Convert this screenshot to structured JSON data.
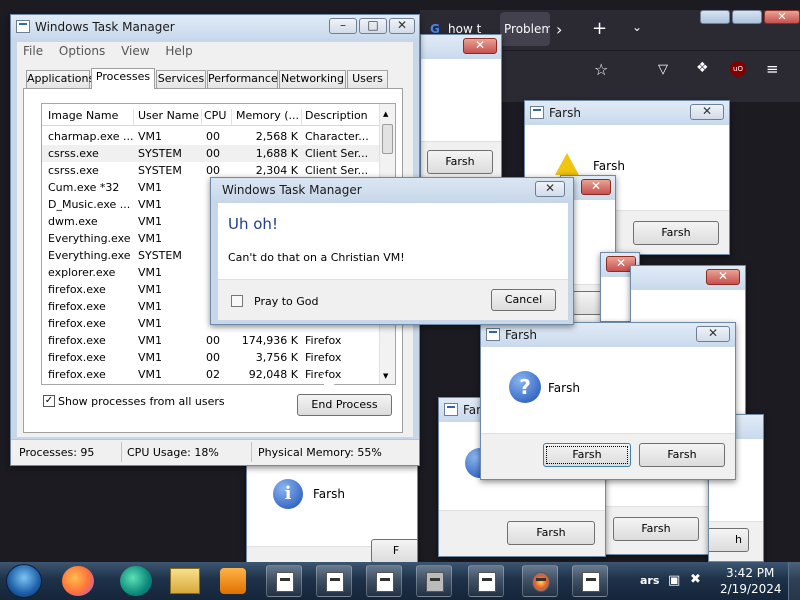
{
  "task_manager": {
    "title": "Windows Task Manager",
    "menu": [
      "File",
      "Options",
      "View",
      "Help"
    ],
    "tabs": [
      "Applications",
      "Processes",
      "Services",
      "Performance",
      "Networking",
      "Users"
    ],
    "columns": [
      "Image Name",
      "User Name",
      "CPU",
      "Memory (...",
      "Description"
    ],
    "rows": [
      [
        "charmap.exe ...",
        "VM1",
        "00",
        "2,568 K",
        "Character..."
      ],
      [
        "csrss.exe",
        "SYSTEM",
        "00",
        "1,688 K",
        "Client Ser..."
      ],
      [
        "csrss.exe",
        "SYSTEM",
        "00",
        "2,304 K",
        "Client Ser..."
      ],
      [
        "Cum.exe *32",
        "VM1",
        "",
        "",
        ""
      ],
      [
        "D_Music.exe ...",
        "VM1",
        "",
        "",
        ""
      ],
      [
        "dwm.exe",
        "VM1",
        "",
        "",
        ""
      ],
      [
        "Everything.exe",
        "VM1",
        "",
        "",
        ""
      ],
      [
        "Everything.exe",
        "SYSTEM",
        "",
        "",
        ""
      ],
      [
        "explorer.exe",
        "VM1",
        "",
        "",
        ""
      ],
      [
        "firefox.exe",
        "VM1",
        "",
        "",
        ""
      ],
      [
        "firefox.exe",
        "VM1",
        "",
        "",
        ""
      ],
      [
        "firefox.exe",
        "VM1",
        "",
        "",
        ""
      ],
      [
        "firefox.exe",
        "VM1",
        "00",
        "174,936 K",
        "Firefox"
      ],
      [
        "firefox.exe",
        "VM1",
        "00",
        "3,756 K",
        "Firefox"
      ],
      [
        "firefox.exe",
        "VM1",
        "02",
        "92,048 K",
        "Firefox"
      ]
    ],
    "show_all_label": "Show processes from all users",
    "end_process_label": "End Process",
    "status": {
      "processes": "Processes: 95",
      "cpu": "CPU Usage: 18%",
      "memory": "Physical Memory: 55%"
    }
  },
  "browser": {
    "tab1_title": "how t",
    "tab2_title": "Problem",
    "new_tab": "+"
  },
  "error_dialog": {
    "title": "Windows Task Manager",
    "heading": "Uh oh!",
    "message": "Can't do that on a Christian VM!",
    "checkbox_label": "Pray to God",
    "cancel_label": "Cancel"
  },
  "farsh_dialogs": {
    "title": "Farsh",
    "message": "Farsh",
    "button": "Farsh",
    "partial_title": "Far",
    "partial_button": "F",
    "partial_text": "ars"
  },
  "clock": {
    "time": "3:42 PM",
    "date": "2/19/2024"
  }
}
